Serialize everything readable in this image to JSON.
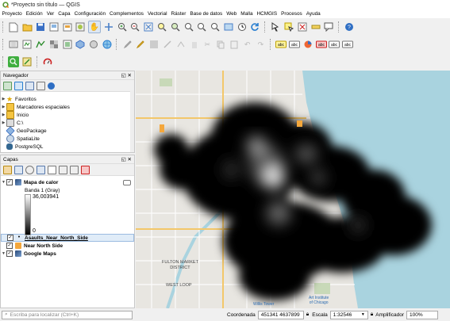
{
  "window": {
    "title": "*Proyecto sin título — QGIS"
  },
  "menu": [
    "Proyecto",
    "Edición",
    "Ver",
    "Capa",
    "Configuración",
    "Complementos",
    "Vectorial",
    "Ráster",
    "Base de datos",
    "Web",
    "Malla",
    "HCMGIS",
    "Procesos",
    "Ayuda"
  ],
  "browser": {
    "title": "Navegador",
    "items": [
      {
        "label": "Favoritos",
        "icon": "star-icon",
        "expandable": true
      },
      {
        "label": "Marcadores espaciales",
        "icon": "bookmark-icon",
        "expandable": true
      },
      {
        "label": "Inicio",
        "icon": "folder-icon",
        "expandable": true
      },
      {
        "label": "C:\\",
        "icon": "drive-icon",
        "expandable": true
      },
      {
        "label": "GeoPackage",
        "icon": "geopackage-icon",
        "expandable": false
      },
      {
        "label": "SpatiaLite",
        "icon": "spatialite-icon",
        "expandable": false
      },
      {
        "label": "PostgreSQL",
        "icon": "postgresql-icon",
        "expandable": false
      }
    ]
  },
  "layers": {
    "title": "Capas",
    "heatmap": {
      "name": "Mapa de calor",
      "band": "Banda 1 (Gray)",
      "max": "36,003941",
      "min": "0"
    },
    "items": [
      {
        "label": "Asaults_Near_North_Side",
        "icon": "point-layer-icon",
        "checked": true,
        "selected": true
      },
      {
        "label": "Near North Side",
        "icon": "polygon-layer-icon",
        "checked": true,
        "selected": false
      },
      {
        "label": "Google Maps",
        "icon": "raster-layer-icon",
        "checked": true,
        "selected": false
      }
    ]
  },
  "map_labels": [
    {
      "text": "FULTON MARKET",
      "sub": "DISTRICT"
    },
    {
      "text": "WEST LOOP",
      "sub": ""
    },
    {
      "text": "Willis Tower",
      "sub": ""
    },
    {
      "text": "Art Institute",
      "sub": ""
    },
    {
      "text": "of Chicago",
      "sub": ""
    }
  ],
  "status": {
    "locator_placeholder": "Escriba para localizar (Ctrl+K)",
    "coord_label": "Coordenada",
    "coord_value": "451341 4637899",
    "scale_label": "Escala",
    "scale_value": "1:32546",
    "magnifier_label": "Amplificador",
    "magnifier_value": "100%"
  },
  "colors": {
    "water": "#a9d3df",
    "land": "#e8e6e1",
    "heat_dark": "#000000",
    "accent": "#589632"
  }
}
